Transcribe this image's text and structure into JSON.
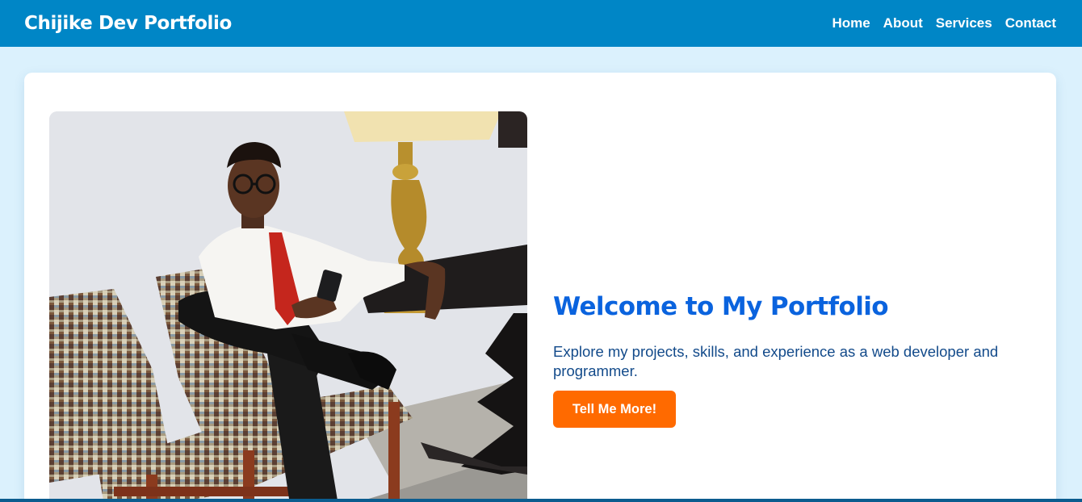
{
  "header": {
    "brand": "Chijike Dev Portfolio",
    "nav": [
      {
        "label": "Home"
      },
      {
        "label": "About"
      },
      {
        "label": "Services"
      },
      {
        "label": "Contact"
      }
    ]
  },
  "hero": {
    "title": "Welcome to My Portfolio",
    "subtitle": "Explore my projects, skills, and experience as a web developer and programmer.",
    "button_label": "Tell Me More!",
    "image_alt": "portrait-photo"
  },
  "colors": {
    "navbar": "#0086c6",
    "page_background": "#dbf1fd",
    "title": "#0a63de",
    "subtitle": "#124a8a",
    "button": "#ff6a00"
  }
}
